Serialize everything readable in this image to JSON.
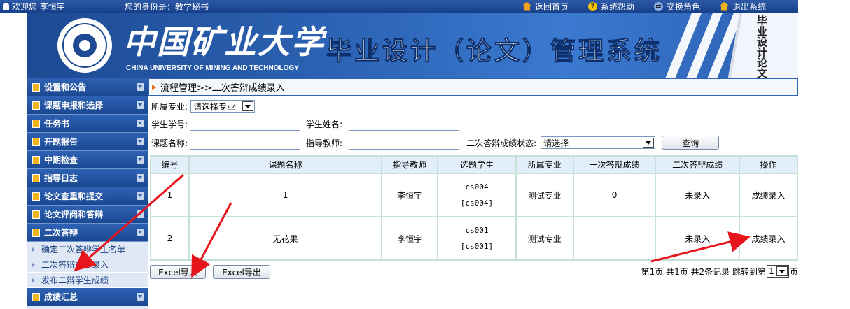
{
  "topbar": {
    "welcome": "欢迎您  李恒宇",
    "role": "您的身份是：教学秘书",
    "links": [
      {
        "label": "返回首页",
        "icon": "home-icon"
      },
      {
        "label": "系统帮助",
        "icon": "help-icon"
      },
      {
        "label": "交换角色",
        "icon": "swap-role-icon"
      },
      {
        "label": "退出系统",
        "icon": "exit-icon"
      }
    ]
  },
  "banner": {
    "university_cn": "中国矿业大学",
    "university_en": "CHINA UNIVERSITY OF MINING AND TECHNOLOGY",
    "system_title": "毕业设计（论文）管理系统",
    "book_text": "毕业设计论文"
  },
  "sidebar": {
    "items": [
      {
        "label": "设置和公告"
      },
      {
        "label": "课题申报和选择"
      },
      {
        "label": "任务书"
      },
      {
        "label": "开题报告"
      },
      {
        "label": "中期检查"
      },
      {
        "label": "指导日志"
      },
      {
        "label": "论文查重和提交"
      },
      {
        "label": "论文评阅和答辩"
      },
      {
        "label": "二次答辩"
      }
    ],
    "subitems": [
      {
        "label": "确定二次答辩学生名单"
      },
      {
        "label": "二次答辩成绩录入"
      },
      {
        "label": "发布二辩学生成绩"
      }
    ],
    "last_item": {
      "label": "成绩汇总"
    }
  },
  "breadcrumb": "流程管理>>二次答辩成绩录入",
  "filters": {
    "major_label": "所属专业:",
    "major_value": "请选择专业",
    "student_id_label": "学生学号:",
    "student_id_value": "",
    "student_name_label": "学生姓名:",
    "student_name_value": "",
    "topic_label": "课题名称:",
    "topic_value": "",
    "teacher_label": "指导教师:",
    "teacher_value": "",
    "status_label": "二次答辩成绩状态:",
    "status_value": "请选择",
    "query_button": "查询"
  },
  "table": {
    "headers": [
      "编号",
      "课题名称",
      "指导教师",
      "选题学生",
      "所属专业",
      "一次答辩成绩",
      "二次答辩成绩",
      "操作"
    ],
    "rows": [
      {
        "id": "1",
        "topic": "1",
        "teacher": "李恒宇",
        "student_name": "cs004",
        "student_id": "[cs004]",
        "major": "测试专业",
        "first_score": "0",
        "second_score": "未录入",
        "action": "成绩录入"
      },
      {
        "id": "2",
        "topic": "无花果",
        "teacher": "李恒宇",
        "student_name": "cs001",
        "student_id": "[cs001]",
        "major": "测试专业",
        "first_score": "",
        "second_score": "未录入",
        "action": "成绩录入"
      }
    ]
  },
  "actions": {
    "import_button": "Excel导入",
    "export_button": "Excel导出"
  },
  "pager": {
    "text": "第1页  共1页  共2条记录  跳转到第",
    "page_value": "1",
    "suffix": "页"
  },
  "colors": {
    "topbar": "#1d4a93",
    "menu": "#2e62b4",
    "annotation_arrow": "#e8141c",
    "table_border": "#c6e2d8"
  }
}
